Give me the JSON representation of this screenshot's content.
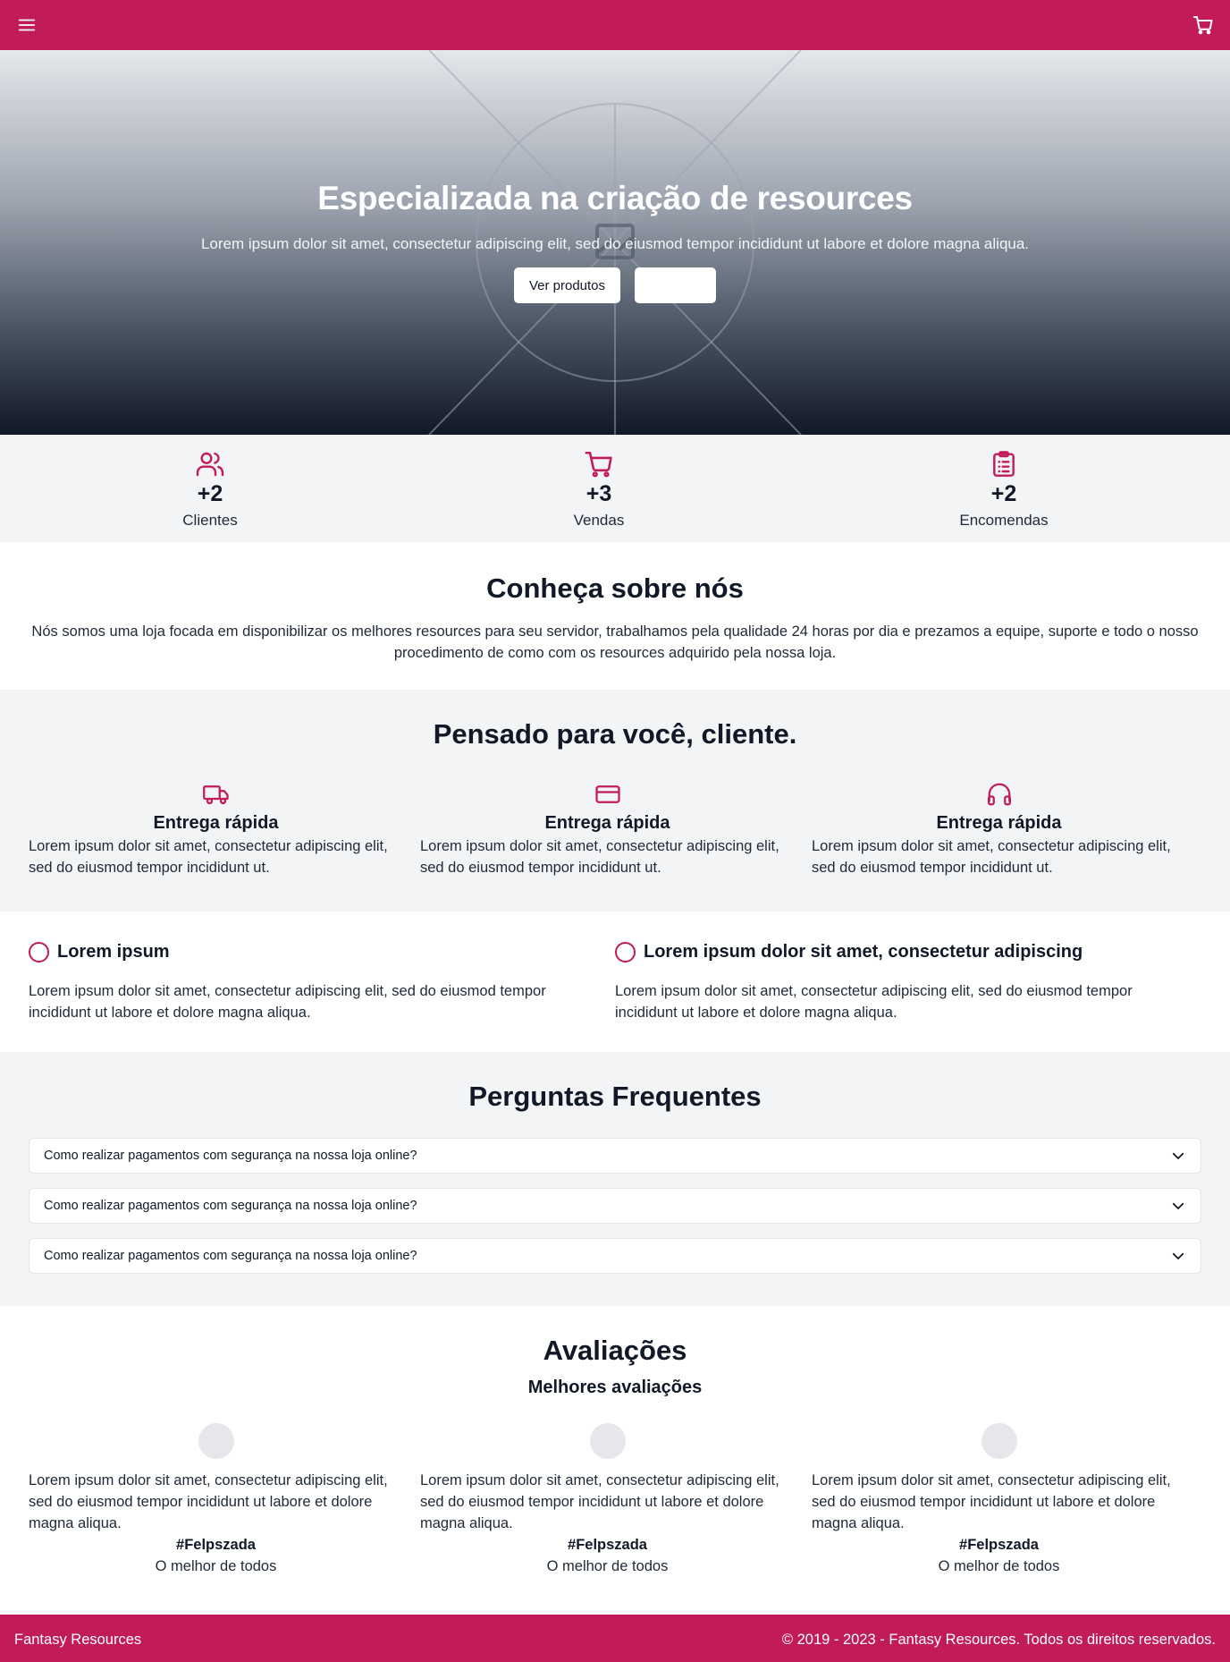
{
  "header": {
    "menu_icon": "menu-icon",
    "cart_icon": "cart-icon",
    "accent_color": "#c21b5a"
  },
  "hero": {
    "title": "Especializada na criação de resources",
    "subtitle": "Lorem ipsum dolor sit amet, consectetur adipiscing elit, sed do eiusmod tempor incididunt ut labore et dolore magna aliqua.",
    "primary_button": "Ver produtos",
    "secondary_button": ""
  },
  "stats": [
    {
      "icon": "users-icon",
      "value": "+2",
      "label": "Clientes"
    },
    {
      "icon": "cart-icon",
      "value": "+3",
      "label": "Vendas"
    },
    {
      "icon": "clipboard-icon",
      "value": "+2",
      "label": "Encomendas"
    }
  ],
  "about": {
    "title": "Conheça sobre nós",
    "text": "Nós somos uma loja focada em disponibilizar os melhores resources para seu servidor, trabalhamos pela qualidade 24 horas por dia e prezamos a equipe, suporte e todo o nosso procedimento de como com os resources adquirido pela nossa loja."
  },
  "features": {
    "title": "Pensado para você, cliente.",
    "items": [
      {
        "icon": "truck-icon",
        "title": "Entrega rápida",
        "text": "Lorem ipsum dolor sit amet, consectetur adipiscing elit, sed do eiusmod tempor incididunt ut."
      },
      {
        "icon": "credit-card-icon",
        "title": "Entrega rápida",
        "text": "Lorem ipsum dolor sit amet, consectetur adipiscing elit, sed do eiusmod tempor incididunt ut."
      },
      {
        "icon": "headphones-icon",
        "title": "Entrega rápida",
        "text": "Lorem ipsum dolor sit amet, consectetur adipiscing elit, sed do eiusmod tempor incididunt ut."
      }
    ]
  },
  "info": [
    {
      "title": "Lorem ipsum",
      "text": "Lorem ipsum dolor sit amet, consectetur adipiscing elit, sed do eiusmod tempor incididunt ut labore et dolore magna aliqua."
    },
    {
      "title": "Lorem ipsum dolor sit amet, consectetur adipiscing",
      "text": "Lorem ipsum dolor sit amet, consectetur adipiscing elit, sed do eiusmod tempor incididunt ut labore et dolore magna aliqua."
    }
  ],
  "faq": {
    "title": "Perguntas Frequentes",
    "items": [
      {
        "question": "Como realizar pagamentos com segurança na nossa loja online?"
      },
      {
        "question": "Como realizar pagamentos com segurança na nossa loja online?"
      },
      {
        "question": "Como realizar pagamentos com segurança na nossa loja online?"
      }
    ]
  },
  "reviews": {
    "title": "Avaliações",
    "subtitle": "Melhores avaliações",
    "items": [
      {
        "text": "Lorem ipsum dolor sit amet, consectetur adipiscing elit, sed do eiusmod tempor incididunt ut labore et dolore magna aliqua.",
        "name": "#Felpszada",
        "role": "O melhor de todos"
      },
      {
        "text": "Lorem ipsum dolor sit amet, consectetur adipiscing elit, sed do eiusmod tempor incididunt ut labore et dolore magna aliqua.",
        "name": "#Felpszada",
        "role": "O melhor de todos"
      },
      {
        "text": "Lorem ipsum dolor sit amet, consectetur adipiscing elit, sed do eiusmod tempor incididunt ut labore et dolore magna aliqua.",
        "name": "#Felpszada",
        "role": "O melhor de todos"
      }
    ]
  },
  "footer": {
    "brand": "Fantasy Resources",
    "copyright": "© 2019 - 2023 - Fantasy Resources. Todos os direitos reservados."
  }
}
